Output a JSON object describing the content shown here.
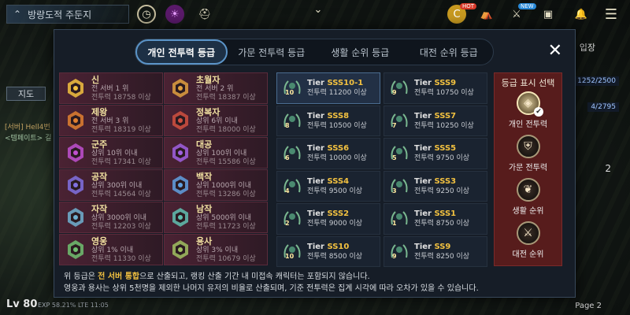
{
  "hud": {
    "zone": "방랑도적 주둔지",
    "hot_badge": "HOT",
    "new_badge": "NEW",
    "map_label": "지도",
    "right_label": "입장",
    "stat1": "1252/2500",
    "stat2": "4/2795",
    "stat3": "2",
    "server_line": "[서버] Hell4번",
    "emote_line": "<템페이트> 길",
    "level": "Lv 80",
    "exp": "EXP 58.21%  LTE  11:05",
    "page": "Page 2"
  },
  "modal": {
    "tabs": [
      "개인 전투력 등급",
      "가문 전투력 등급",
      "생활 순위 등급",
      "대전 순위 등급"
    ],
    "active_tab": 0,
    "close_label": "✕"
  },
  "grades": [
    {
      "name": "신",
      "desc": "전 서버 1 위",
      "req": "전투력 18758 이상",
      "color": "#f2c140"
    },
    {
      "name": "초월자",
      "desc": "전 서버 2 위",
      "req": "전투력 18387 이상",
      "color": "#e0a040"
    },
    {
      "name": "제왕",
      "desc": "전 서버 3 위",
      "req": "전투력 18319 이상",
      "color": "#e08030"
    },
    {
      "name": "정복자",
      "desc": "상위 6위 이내",
      "req": "전투력 18000 이상",
      "color": "#d05040"
    },
    {
      "name": "군주",
      "desc": "상위 10위 이내",
      "req": "전투력 17341 이상",
      "color": "#c050d0"
    },
    {
      "name": "대공",
      "desc": "상위 100위 이내",
      "req": "전투력 15586 이상",
      "color": "#a060e0"
    },
    {
      "name": "공작",
      "desc": "상위 300위 이내",
      "req": "전투력 14564 이상",
      "color": "#8070e0"
    },
    {
      "name": "백작",
      "desc": "상위 1000위 이내",
      "req": "전투력 13286 이상",
      "color": "#60a0e0"
    },
    {
      "name": "자작",
      "desc": "상위 3000위 이내",
      "req": "전투력 12203 이상",
      "color": "#70b0d0"
    },
    {
      "name": "남작",
      "desc": "상위 5000위 이내",
      "req": "전투력 11723 이상",
      "color": "#60c0b0"
    },
    {
      "name": "영웅",
      "desc": "상위 1% 이내",
      "req": "전투력 11330 이상",
      "color": "#70c070"
    },
    {
      "name": "용사",
      "desc": "상위 3% 이내",
      "req": "전투력 10679 이상",
      "color": "#a0c060"
    }
  ],
  "tiers": [
    {
      "prefix": "Tier ",
      "level": "SSS10-1",
      "req": "전투력 11200 이상",
      "num": "10"
    },
    {
      "prefix": "Tier ",
      "level": "SSS9",
      "req": "전투력 10750 이상",
      "num": "9"
    },
    {
      "prefix": "Tier ",
      "level": "SSS8",
      "req": "전투력 10500 이상",
      "num": "8"
    },
    {
      "prefix": "Tier ",
      "level": "SSS7",
      "req": "전투력 10250 이상",
      "num": "7"
    },
    {
      "prefix": "Tier ",
      "level": "SSS6",
      "req": "전투력 10000 이상",
      "num": "6"
    },
    {
      "prefix": "Tier ",
      "level": "SSS5",
      "req": "전투력 9750 이상",
      "num": "5"
    },
    {
      "prefix": "Tier ",
      "level": "SSS4",
      "req": "전투력 9500 이상",
      "num": "4"
    },
    {
      "prefix": "Tier ",
      "level": "SSS3",
      "req": "전투력 9250 이상",
      "num": "3"
    },
    {
      "prefix": "Tier ",
      "level": "SSS2",
      "req": "전투력 9000 이상",
      "num": "2"
    },
    {
      "prefix": "Tier ",
      "level": "SSS1",
      "req": "전투력 8750 이상",
      "num": "1"
    },
    {
      "prefix": "Tier ",
      "level": "SS10",
      "req": "전투력 8500 이상",
      "num": "10"
    },
    {
      "prefix": "Tier ",
      "level": "SS9",
      "req": "전투력 8250 이상",
      "num": "9"
    }
  ],
  "selector": {
    "title": "등급 표시 선택",
    "items": [
      "개인 전투력",
      "가문 전투력",
      "생활 순위",
      "대전 순위"
    ],
    "active": 0
  },
  "notes": {
    "line1_pre": "위 등급은 ",
    "line1_hl": "전 서버 통합",
    "line1_post": "으로 산출되고, 랭킹 산출 기간 내 미접속 캐릭터는 포함되지 않습니다.",
    "line2": "영웅과 용사는 상위 5천명을 제외한 나머지 유저의 비율로 산출되며, 기준 전투력은 집계 시각에 따라 오차가 있을 수 있습니다."
  }
}
